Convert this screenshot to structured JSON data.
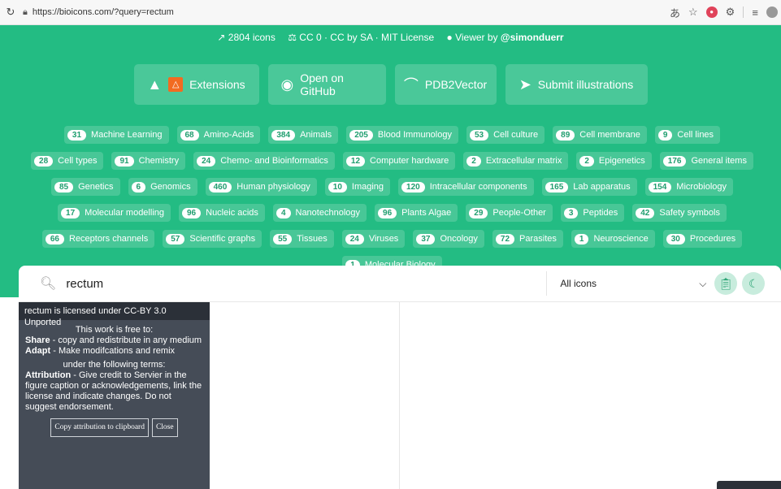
{
  "browser": {
    "url": "https://bioicons.com/?query=rectum"
  },
  "stats": {
    "icons": "2804 icons",
    "license": "CC 0 · CC by SA · MIT License",
    "viewer_prefix": "Viewer by",
    "viewer_user": "@simonduerr"
  },
  "buttons": {
    "extensions": "Extensions",
    "github": "Open on GitHub",
    "pdb2vector": "PDB2Vector",
    "submit": "Submit illustrations"
  },
  "categories": [
    {
      "count": "31",
      "label": "Machine Learning"
    },
    {
      "count": "68",
      "label": "Amino-Acids"
    },
    {
      "count": "384",
      "label": "Animals"
    },
    {
      "count": "205",
      "label": "Blood Immunology"
    },
    {
      "count": "53",
      "label": "Cell culture"
    },
    {
      "count": "89",
      "label": "Cell membrane"
    },
    {
      "count": "9",
      "label": "Cell lines"
    },
    {
      "count": "28",
      "label": "Cell types"
    },
    {
      "count": "91",
      "label": "Chemistry"
    },
    {
      "count": "24",
      "label": "Chemo- and Bioinformatics"
    },
    {
      "count": "12",
      "label": "Computer hardware"
    },
    {
      "count": "2",
      "label": "Extracellular matrix"
    },
    {
      "count": "2",
      "label": "Epigenetics"
    },
    {
      "count": "176",
      "label": "General items"
    },
    {
      "count": "85",
      "label": "Genetics"
    },
    {
      "count": "6",
      "label": "Genomics"
    },
    {
      "count": "460",
      "label": "Human physiology"
    },
    {
      "count": "10",
      "label": "Imaging"
    },
    {
      "count": "120",
      "label": "Intracellular components"
    },
    {
      "count": "165",
      "label": "Lab apparatus"
    },
    {
      "count": "154",
      "label": "Microbiology"
    },
    {
      "count": "17",
      "label": "Molecular modelling"
    },
    {
      "count": "96",
      "label": "Nucleic acids"
    },
    {
      "count": "4",
      "label": "Nanotechnology"
    },
    {
      "count": "96",
      "label": "Plants Algae"
    },
    {
      "count": "29",
      "label": "People-Other"
    },
    {
      "count": "3",
      "label": "Peptides"
    },
    {
      "count": "42",
      "label": "Safety symbols"
    },
    {
      "count": "66",
      "label": "Receptors channels"
    },
    {
      "count": "57",
      "label": "Scientific graphs"
    },
    {
      "count": "55",
      "label": "Tissues"
    },
    {
      "count": "24",
      "label": "Viruses"
    },
    {
      "count": "37",
      "label": "Oncology"
    },
    {
      "count": "72",
      "label": "Parasites"
    },
    {
      "count": "1",
      "label": "Neuroscience"
    },
    {
      "count": "30",
      "label": "Procedures"
    },
    {
      "count": "1",
      "label": "Molecular Biology"
    }
  ],
  "search": {
    "value": "rectum",
    "filter_selected": "All icons"
  },
  "license_panel": {
    "header": "rectum is licensed under CC-BY 3.0 Unported",
    "free_to": "This work is free to:",
    "share_label": "Share",
    "share_text": " - copy and redistribute in any medium",
    "adapt_label": "Adapt",
    "adapt_text": " - Make modifcations and remix",
    "terms": "under the following terms:",
    "attribution_label": "Attribution",
    "attribution_text": " - Give credit to Servier in the figure caption or acknowledgements, link the license and indicate changes. Do not suggest endorsement.",
    "copy_button": "Copy attribution to clipboard",
    "close_button": "Close"
  },
  "colors": {
    "brand_green": "#23bc83",
    "panel_dark": "#454c57"
  }
}
